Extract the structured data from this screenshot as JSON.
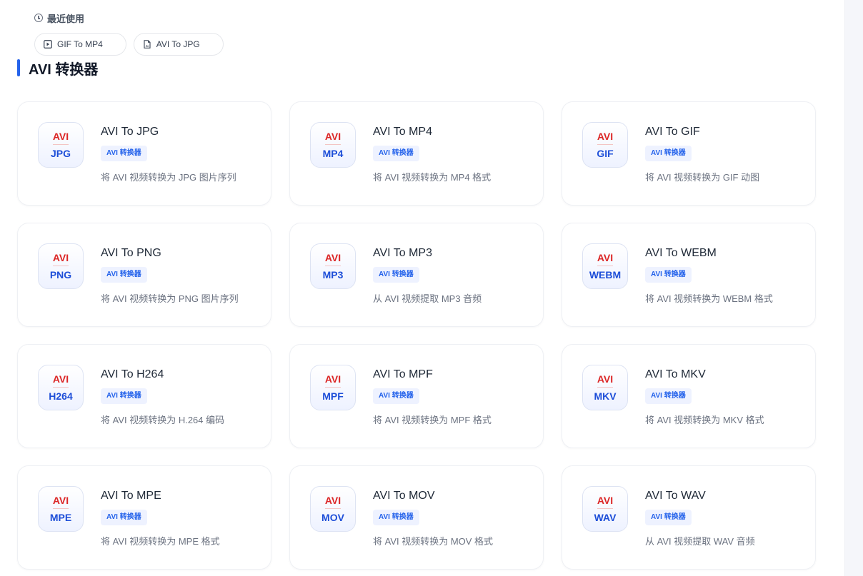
{
  "recent": {
    "title": "最近使用",
    "items": [
      {
        "label": "GIF To MP4",
        "icon": "video-file-icon"
      },
      {
        "label": "AVI To JPG",
        "icon": "image-file-icon"
      }
    ]
  },
  "section": {
    "title": "AVI 转换器"
  },
  "tools": [
    {
      "src": "AVI",
      "dst": "JPG",
      "title": "AVI To JPG",
      "badge": "AVI 转换器",
      "desc": "将 AVI 视频转换为 JPG 图片序列"
    },
    {
      "src": "AVI",
      "dst": "MP4",
      "title": "AVI To MP4",
      "badge": "AVI 转换器",
      "desc": "将 AVI 视频转换为 MP4 格式"
    },
    {
      "src": "AVI",
      "dst": "GIF",
      "title": "AVI To GIF",
      "badge": "AVI 转换器",
      "desc": "将 AVI 视频转换为 GIF 动图"
    },
    {
      "src": "AVI",
      "dst": "PNG",
      "title": "AVI To PNG",
      "badge": "AVI 转换器",
      "desc": "将 AVI 视频转换为 PNG 图片序列"
    },
    {
      "src": "AVI",
      "dst": "MP3",
      "title": "AVI To MP3",
      "badge": "AVI 转换器",
      "desc": "从 AVI 视频提取 MP3 音频"
    },
    {
      "src": "AVI",
      "dst": "WEBM",
      "title": "AVI To WEBM",
      "badge": "AVI 转换器",
      "desc": "将 AVI 视频转换为 WEBM 格式"
    },
    {
      "src": "AVI",
      "dst": "H264",
      "title": "AVI To H264",
      "badge": "AVI 转换器",
      "desc": "将 AVI 视频转换为 H.264 编码"
    },
    {
      "src": "AVI",
      "dst": "MPF",
      "title": "AVI To MPF",
      "badge": "AVI 转换器",
      "desc": "将 AVI 视频转换为 MPF 格式"
    },
    {
      "src": "AVI",
      "dst": "MKV",
      "title": "AVI To MKV",
      "badge": "AVI 转换器",
      "desc": "将 AVI 视频转换为 MKV 格式"
    },
    {
      "src": "AVI",
      "dst": "MPE",
      "title": "AVI To MPE",
      "badge": "AVI 转换器",
      "desc": "将 AVI 视频转换为 MPE 格式"
    },
    {
      "src": "AVI",
      "dst": "MOV",
      "title": "AVI To MOV",
      "badge": "AVI 转换器",
      "desc": "将 AVI 视频转换为 MOV 格式"
    },
    {
      "src": "AVI",
      "dst": "WAV",
      "title": "AVI To WAV",
      "badge": "AVI 转换器",
      "desc": "从 AVI 视频提取 WAV 音频"
    }
  ],
  "colors": {
    "accent": "#2563eb",
    "source_format": "#dc2626",
    "target_format": "#1d4ed8"
  }
}
